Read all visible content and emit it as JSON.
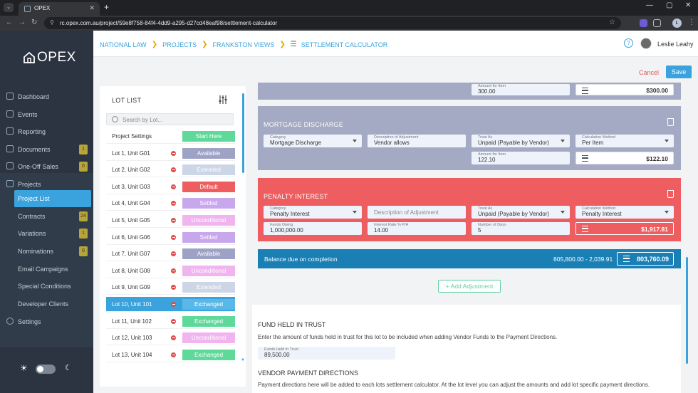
{
  "browser": {
    "tab_title": "OPEX",
    "url": "rc.opex.com.au/project/59e8f758-84f4-4dd9-a295-d27cd48eaf98/settlement-calculator",
    "profile_initial": "L"
  },
  "sidebar": {
    "logo": "OPEX",
    "items": [
      {
        "label": "Dashboard",
        "icon": "dashboard-icon"
      },
      {
        "label": "Events",
        "icon": "calendar-icon"
      },
      {
        "label": "Reporting",
        "icon": "chart-icon"
      },
      {
        "label": "Documents",
        "icon": "document-icon",
        "badge": "1"
      },
      {
        "label": "One-Off Sales",
        "icon": "cart-icon",
        "badge": "0"
      },
      {
        "label": "Projects",
        "icon": "stack-icon"
      },
      {
        "label": "Project List"
      },
      {
        "label": "Contracts",
        "badge": "24"
      },
      {
        "label": "Variations",
        "badge": "1"
      },
      {
        "label": "Nominations",
        "badge": "0"
      },
      {
        "label": "Email Campaigns"
      },
      {
        "label": "Special Conditions"
      },
      {
        "label": "Developer Clients"
      },
      {
        "label": "Settings",
        "icon": "gear-icon"
      }
    ]
  },
  "header": {
    "breadcrumbs": [
      "NATIONAL LAW",
      "PROJECTS",
      "FRANKSTON VIEWS",
      "SETTLEMENT CALCULATOR"
    ],
    "user": "Leslie Leahy",
    "help": "?"
  },
  "actions": {
    "cancel": "Cancel",
    "save": "Save"
  },
  "lot_list": {
    "title": "LOT LIST",
    "search_placeholder": "Search by Lot...",
    "rows": [
      {
        "name": "Project Settings",
        "status": "Start Here",
        "color": "#5fd99a"
      },
      {
        "name": "Lot 1, Unit G01",
        "status": "Available",
        "color": "#9ea3c6"
      },
      {
        "name": "Lot 2, Unit G02",
        "status": "Extended",
        "color": "#cdd6e6"
      },
      {
        "name": "Lot 3, Unit G03",
        "status": "Default",
        "color": "#ee5d5f"
      },
      {
        "name": "Lot 4, Unit G04",
        "status": "Settled",
        "color": "#c9a7ec"
      },
      {
        "name": "Lot 5, Unit G05",
        "status": "Unconditional",
        "color": "#f0b5ef"
      },
      {
        "name": "Lot 6, Unit G06",
        "status": "Settled",
        "color": "#c9a7ec"
      },
      {
        "name": "Lot 7, Unit G07",
        "status": "Available",
        "color": "#9ea3c6"
      },
      {
        "name": "Lot 8, Unit G08",
        "status": "Unconditional",
        "color": "#f0b5ef"
      },
      {
        "name": "Lot 9, Unit G09",
        "status": "Extended",
        "color": "#cdd6e6"
      },
      {
        "name": "Lot 10, Unit 101",
        "status": "Exchanged",
        "color": "#5ab8e8",
        "selected": true
      },
      {
        "name": "Lot 11, Unit 102",
        "status": "Exchanged",
        "color": "#5fd99a"
      },
      {
        "name": "Lot 12, Unit 103",
        "status": "Unconditional",
        "color": "#f0b5ef"
      },
      {
        "name": "Lot 13, Unit 104",
        "status": "Exchanged",
        "color": "#5fd99a"
      }
    ]
  },
  "calculator": {
    "top_card": {
      "amount_label": "Amount for Item",
      "amount": "300.00",
      "total": "$300.00"
    },
    "mortgage": {
      "title": "MORTGAGE DISCHARGE",
      "category_label": "Category",
      "category": "Mortgage Discharge",
      "desc_label": "Description of Adjustment",
      "desc": "Vendor allows",
      "treat_label": "Treat As",
      "treat": "Unpaid (Payable by Vendor)",
      "method_label": "Calculation Method",
      "method": "Per Item",
      "amount_label": "Amount for Item",
      "amount": "122.10",
      "total": "$122.10"
    },
    "penalty": {
      "title": "PENALTY INTEREST",
      "category_label": "Category",
      "category": "Penalty Interest",
      "desc_placeholder": "Description of Adjustment",
      "treat_label": "Treat As",
      "treat": "Unpaid (Payable by Vendor)",
      "method_label": "Calculation Method",
      "method": "Penalty Interest",
      "owing_label": "Funds Owing",
      "owing": "1,000,000.00",
      "rate_label": "Interest Rate % P/A",
      "rate": "14.00",
      "days_label": "Number of Days",
      "days": "5",
      "total": "$1,917.81"
    },
    "balance": {
      "label": "Balance due on completion",
      "calc": "805,800.00 - 2,039.91",
      "value": "803,760.09"
    },
    "add_adjustment": "+ Add Adjustment",
    "funds_in_trust": {
      "title": "FUND HELD IN TRUST",
      "desc": "Enter the amount of funds held in trust for this lot to be included when adding Vendor Funds to the Payment Directions.",
      "field_label": "Funds Held In Trust",
      "field_value": "89,500.00"
    },
    "vendor_payment": {
      "title": "VENDOR PAYMENT DIRECTIONS",
      "desc": "Payment directions here will be added to each lots settlement calculator. At the lot level you can adjust the amounts and add lot specific payment directions."
    }
  }
}
